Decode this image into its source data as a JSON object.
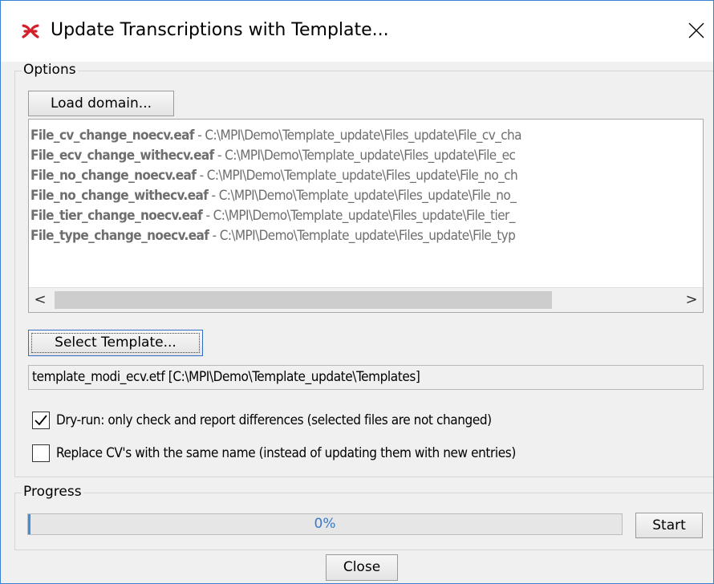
{
  "window": {
    "title": "Update Transcriptions with Template...",
    "icon": "elan-app-icon",
    "close_icon": "close-icon"
  },
  "options": {
    "group_label": "Options",
    "load_domain_label": "Load domain...",
    "files": [
      {
        "name": "File_cv_change_noecv.eaf",
        "path": " - C:\\MPI\\Demo\\Template_update\\Files_update\\File_cv_cha"
      },
      {
        "name": "File_ecv_change_withecv.eaf",
        "path": " - C:\\MPI\\Demo\\Template_update\\Files_update\\File_ec"
      },
      {
        "name": "File_no_change_noecv.eaf",
        "path": " - C:\\MPI\\Demo\\Template_update\\Files_update\\File_no_ch"
      },
      {
        "name": "File_no_change_withecv.eaf",
        "path": " - C:\\MPI\\Demo\\Template_update\\Files_update\\File_no_"
      },
      {
        "name": "File_tier_change_noecv.eaf",
        "path": " - C:\\MPI\\Demo\\Template_update\\Files_update\\File_tier_"
      },
      {
        "name": "File_type_change_noecv.eaf",
        "path": " - C:\\MPI\\Demo\\Template_update\\Files_update\\File_typ"
      }
    ],
    "scroll_left_glyph": "<",
    "scroll_right_glyph": ">",
    "select_template_label": "Select Template...",
    "template_value": "template_modi_ecv.etf  [C:\\MPI\\Demo\\Template_update\\Templates]",
    "dry_run": {
      "checked": true,
      "label": "Dry-run: only check and report differences (selected files are not changed)"
    },
    "replace_cv": {
      "checked": false,
      "label": "Replace CV's with the same name (instead of updating them with new entries)"
    }
  },
  "progress": {
    "group_label": "Progress",
    "percent_text": "0%",
    "fraction": 0.0,
    "start_label": "Start"
  },
  "footer": {
    "close_label": "Close"
  },
  "colors": {
    "accent": "#3b8fdf",
    "icon_red": "#d21f2a"
  }
}
